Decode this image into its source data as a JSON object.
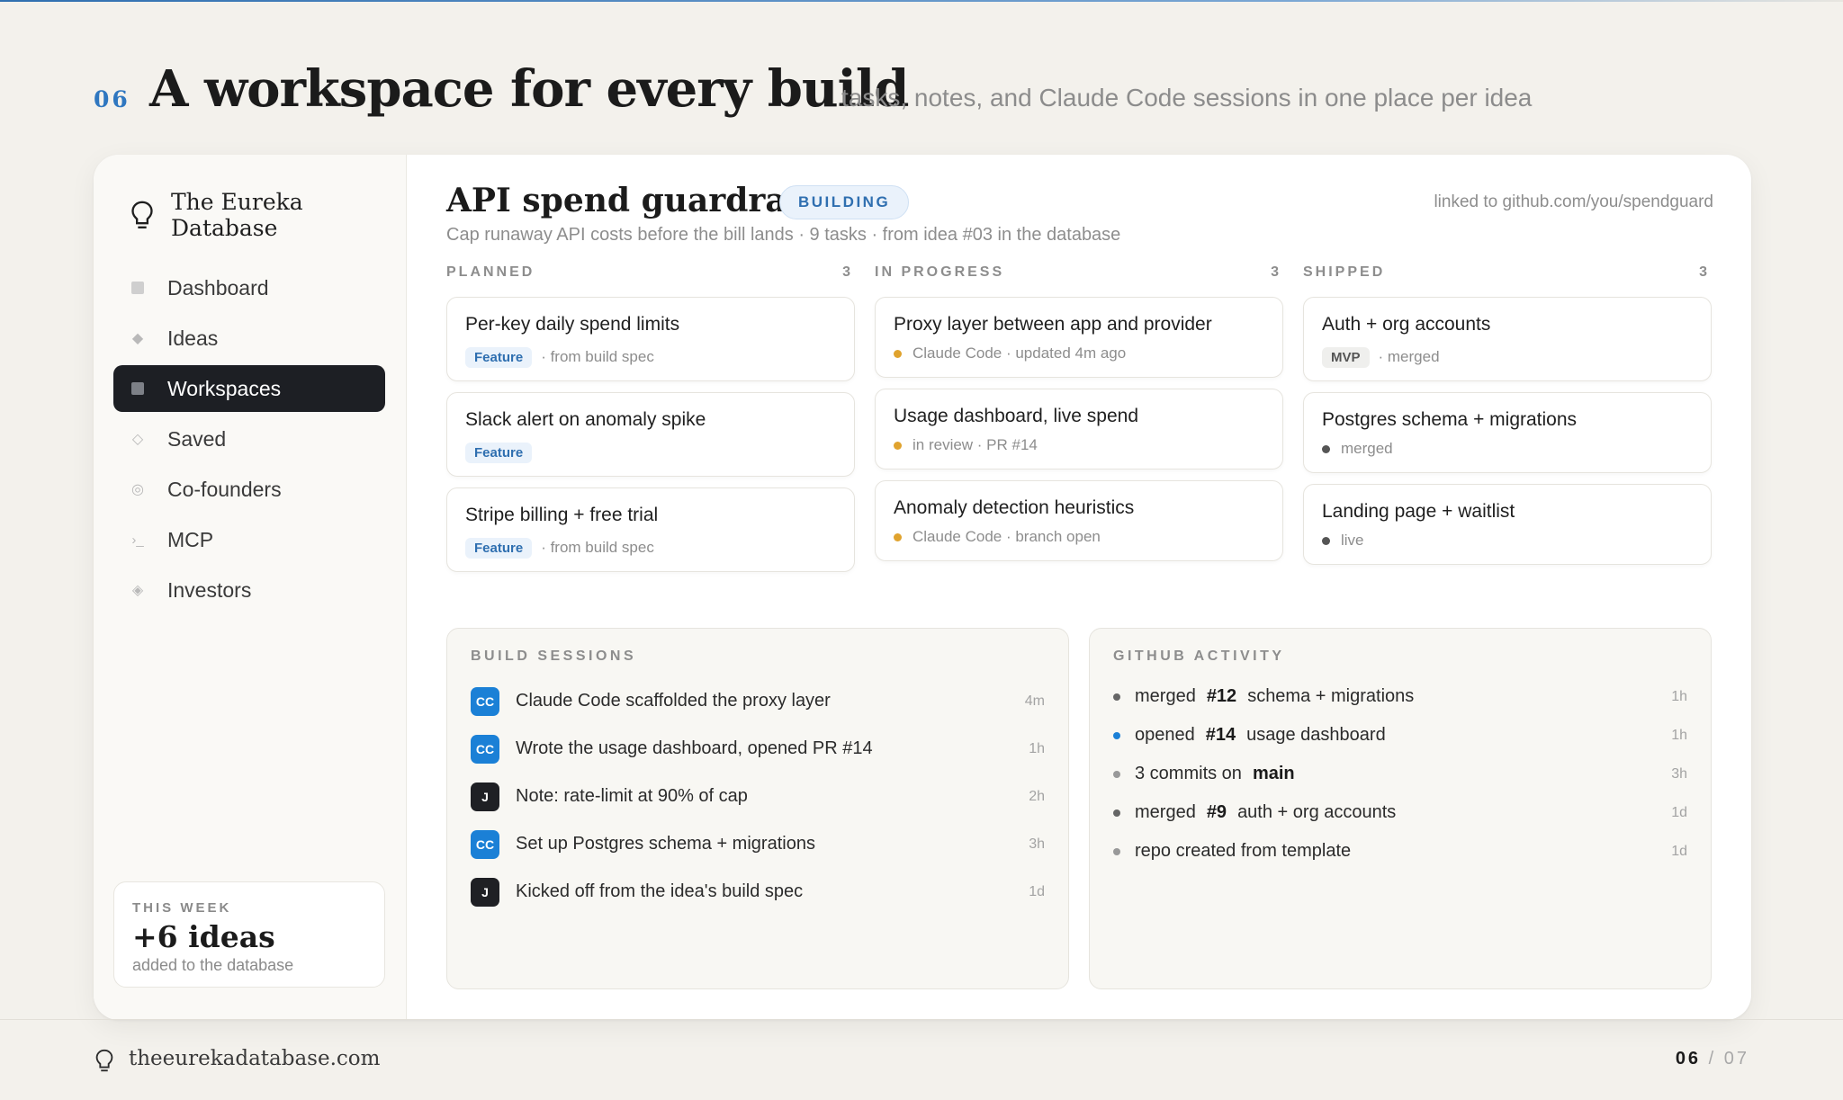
{
  "slide": {
    "number": "06",
    "title": "A workspace for every build",
    "subtitle": "tasks, notes, and Claude Code sessions in one place per idea"
  },
  "sidebar": {
    "brand": "The Eureka Database",
    "brand_icon": "lightbulb-icon",
    "items": [
      {
        "label": "Dashboard",
        "icon": "square-icon"
      },
      {
        "label": "Ideas",
        "icon": "diamond-icon"
      },
      {
        "label": "Workspaces",
        "icon": "square-icon",
        "active": true
      },
      {
        "label": "Saved",
        "icon": "diamond-outline-icon"
      },
      {
        "label": "Co-founders",
        "icon": "circle-icon"
      },
      {
        "label": "MCP",
        "icon": "terminal-icon"
      },
      {
        "label": "Investors",
        "icon": "sparkle-icon"
      }
    ],
    "week": {
      "label": "THIS WEEK",
      "value": "+6 ideas",
      "sub": "added to the database"
    }
  },
  "workspace": {
    "title": "API spend guardrail",
    "status": "BUILDING",
    "meta": "Cap runaway API costs before the bill lands · 9 tasks · from idea #03 in the database",
    "link": "linked to github.com/you/spendguard"
  },
  "board": {
    "columns": [
      {
        "name": "PLANNED",
        "count": "3",
        "tasks": [
          {
            "title": "Per-key daily spend limits",
            "tag": "Feature",
            "meta": "· from build spec"
          },
          {
            "title": "Slack alert on anomaly spike",
            "tag": "Feature",
            "meta": ""
          },
          {
            "title": "Stripe billing + free trial",
            "tag": "Feature",
            "meta": "· from build spec"
          }
        ]
      },
      {
        "name": "IN PROGRESS",
        "count": "3",
        "tasks": [
          {
            "title": "Proxy layer between app and provider",
            "meta": "Claude Code · updated 4m ago"
          },
          {
            "title": "Usage dashboard, live spend",
            "meta": "in review · PR #14"
          },
          {
            "title": "Anomaly detection heuristics",
            "meta": "Claude Code · branch open"
          }
        ]
      },
      {
        "name": "SHIPPED",
        "count": "3",
        "tasks": [
          {
            "title": "Auth + org accounts",
            "tag": "MVP",
            "meta": "· merged"
          },
          {
            "title": "Postgres schema + migrations",
            "meta": "merged"
          },
          {
            "title": "Landing page + waitlist",
            "meta": "live"
          }
        ]
      }
    ]
  },
  "sessions": {
    "heading": "BUILD SESSIONS",
    "items": [
      {
        "avatar": "CC",
        "text": "Claude Code scaffolded the proxy layer",
        "time": "4m"
      },
      {
        "avatar": "CC",
        "text": "Wrote the usage dashboard, opened PR #14",
        "time": "1h"
      },
      {
        "avatar": "J",
        "text": "Note: rate-limit at 90% of cap",
        "time": "2h"
      },
      {
        "avatar": "CC",
        "text": "Set up Postgres schema + migrations",
        "time": "3h"
      },
      {
        "avatar": "J",
        "text": "Kicked off from the idea's build spec",
        "time": "1d"
      }
    ]
  },
  "github": {
    "heading": "GITHUB ACTIVITY",
    "items": [
      {
        "verb": "merged",
        "ref": "#12",
        "desc": "schema + migrations",
        "time": "1h",
        "color": "#666666"
      },
      {
        "verb": "opened",
        "ref": "#14",
        "desc": "usage dashboard",
        "time": "1h",
        "color": "#1b80d6"
      },
      {
        "verb": "3 commits on",
        "ref": "main",
        "desc": "",
        "time": "3h",
        "color": "#999999"
      },
      {
        "verb": "merged",
        "ref": "#9",
        "desc": "auth + org accounts",
        "time": "1d",
        "color": "#666666"
      },
      {
        "verb": "repo created from template",
        "ref": "",
        "desc": "",
        "time": "1d",
        "color": "#999999"
      }
    ]
  },
  "footer": {
    "site": "theeurekadatabase.com",
    "page_current": "06",
    "page_sep": "/",
    "page_total": "07"
  },
  "colors": {
    "accent": "#2f6fb0",
    "claude_code": "#1b80d6",
    "in_progress": "#e0a32e",
    "active_nav": "#1d1f24"
  }
}
